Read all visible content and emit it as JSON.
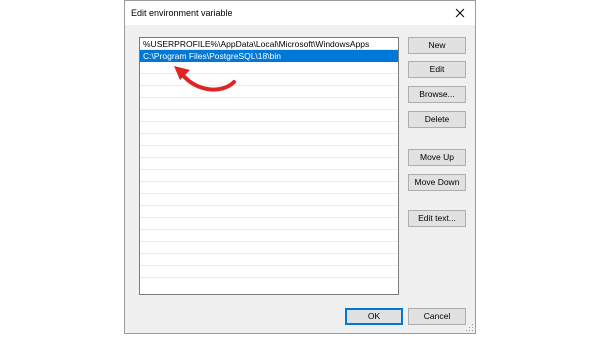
{
  "window": {
    "title": "Edit environment variable",
    "close_glyph": "✕"
  },
  "list": {
    "items": [
      {
        "value": "%USERPROFILE%\\AppData\\Local\\Microsoft\\WindowsApps",
        "selected": false
      },
      {
        "value": "C:\\Program Files\\PostgreSQL\\18\\bin",
        "selected": true
      }
    ],
    "empty_row_count": 18
  },
  "buttons": {
    "new": "New",
    "edit": "Edit",
    "browse": "Browse...",
    "delete": "Delete",
    "move_up": "Move Up",
    "move_down": "Move Down",
    "edit_text": "Edit text...",
    "ok": "OK",
    "cancel": "Cancel"
  },
  "annotation": {
    "arrow_color": "#e02424",
    "icon": "curved-arrow-icon"
  },
  "colors": {
    "selection": "#0078d7",
    "dialog_background": "#f0f0f0"
  }
}
